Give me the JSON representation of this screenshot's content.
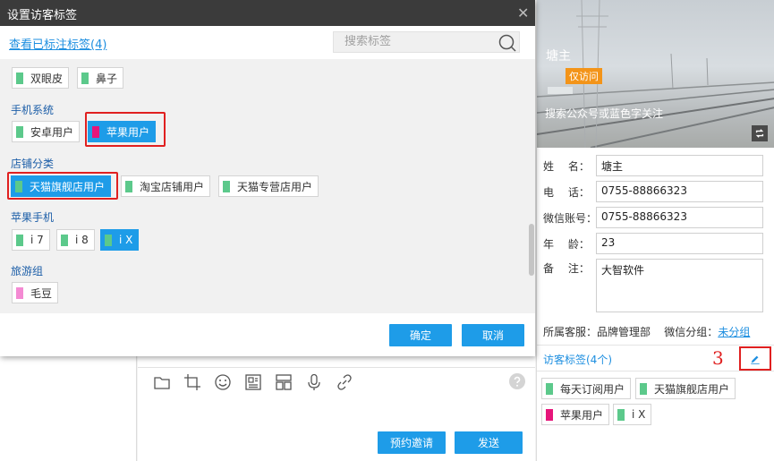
{
  "colors": {
    "accent": "#1e9ce8",
    "link": "#1e8fe0",
    "group_title": "#1c5ea8",
    "highlight_red": "#e02020",
    "tag_green": "#5cc98b",
    "tag_magenta": "#e6157a",
    "tag_pink": "#f48ad3",
    "badge_orange": "#f39419",
    "titlebar": "#3b3b3b"
  },
  "dialog": {
    "title": "设置访客标签",
    "close_icon": "close-icon",
    "view_link": "查看已标注标签(4)",
    "search_placeholder": "搜索标签",
    "search_icon": "search-icon",
    "groups": {
      "face": {
        "tags": [
          {
            "label": "双眼皮",
            "color": "#5cc98b",
            "selected": false
          },
          {
            "label": "鼻子",
            "color": "#5cc98b",
            "selected": false
          }
        ]
      },
      "phone_system": {
        "title": "手机系统",
        "tags": [
          {
            "label": "安卓用户",
            "color": "#5cc98b",
            "selected": false
          },
          {
            "label": "苹果用户",
            "color": "#e6157a",
            "selected": true
          }
        ]
      },
      "shop": {
        "title": "店铺分类",
        "tags": [
          {
            "label": "天猫旗舰店用户",
            "color": "#5cc98b",
            "selected": true
          },
          {
            "label": "淘宝店铺用户",
            "color": "#5cc98b",
            "selected": false
          },
          {
            "label": "天猫专营店用户",
            "color": "#5cc98b",
            "selected": false
          }
        ]
      },
      "apple_phone": {
        "title": "苹果手机",
        "tags": [
          {
            "label": "i 7",
            "color": "#5cc98b",
            "selected": false
          },
          {
            "label": "i 8",
            "color": "#5cc98b",
            "selected": false
          },
          {
            "label": "i X",
            "color": "#5cc98b",
            "selected": true
          }
        ]
      },
      "travel": {
        "title": "旅游组",
        "tags": [
          {
            "label": "毛豆",
            "color": "#f48ad3",
            "selected": false
          }
        ]
      }
    },
    "confirm_label": "确定",
    "cancel_label": "取消"
  },
  "chat": {
    "toolbar_icons": [
      "folder-icon",
      "crop-icon",
      "emoji-icon",
      "card-icon",
      "layout-icon",
      "microphone-icon",
      "link-icon"
    ],
    "help_icon": "help-icon",
    "invite_label": "预约邀请",
    "send_label": "发送"
  },
  "profile": {
    "banner_name": "塘主",
    "banner_badge": "仅访问",
    "banner_hint": "搜索公众号或蓝色字关注",
    "swap_icon": "swap-icon",
    "fields": {
      "name": {
        "label": "姓　 名：",
        "value": "塘主"
      },
      "phone": {
        "label": "电　 话：",
        "value": "0755-88866323"
      },
      "wechat": {
        "label": "微信账号：",
        "value": "0755-88866323"
      },
      "age": {
        "label": "年　 龄：",
        "value": "23"
      },
      "remark": {
        "label": "备　 注：",
        "value": "大智软件"
      }
    },
    "service_label": "所属客服：",
    "service_value": "品牌管理部",
    "wechat_group_label": "微信分组：",
    "wechat_group_value": "未分组",
    "visitor_tags_title": "访客标签(4个)",
    "annotation_number": "3",
    "edit_icon": "pencil-icon",
    "visitor_tags": [
      {
        "label": "每天订阅用户",
        "color": "#5cc98b"
      },
      {
        "label": "天猫旗舰店用户",
        "color": "#5cc98b"
      },
      {
        "label": "苹果用户",
        "color": "#e6157a"
      },
      {
        "label": "i X",
        "color": "#5cc98b"
      }
    ]
  }
}
